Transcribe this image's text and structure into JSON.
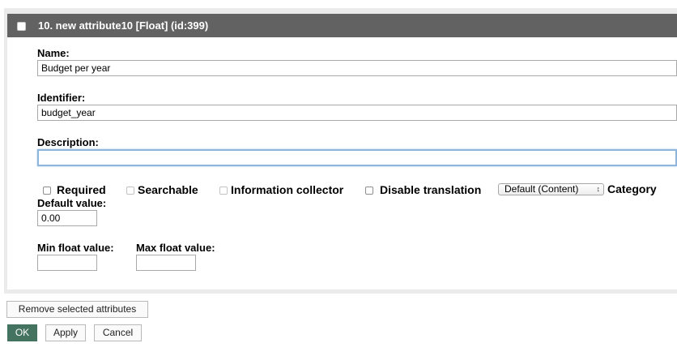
{
  "attribute": {
    "title": "10. new attribute10 [Float] (id:399)",
    "name_label": "Name:",
    "name_value": "Budget per year",
    "identifier_label": "Identifier:",
    "identifier_value": "budget_year",
    "description_label": "Description:",
    "description_value": "",
    "flags": {
      "required": "Required",
      "searchable": "Searchable",
      "information_collector": "Information collector",
      "disable_translation": "Disable translation"
    },
    "category_selected": "Default (Content)",
    "category_label": "Category",
    "default_value_label": "Default value:",
    "default_value": "0.00",
    "min_label": "Min float value:",
    "min_value": "",
    "max_label": "Max float value:",
    "max_value": ""
  },
  "actions": {
    "remove_selected": "Remove selected attributes",
    "ok": "OK",
    "apply": "Apply",
    "cancel": "Cancel"
  },
  "colors": {
    "header_bg": "#626262",
    "ok_button": "#44735f",
    "focus_ring": "#8eb6dc"
  }
}
